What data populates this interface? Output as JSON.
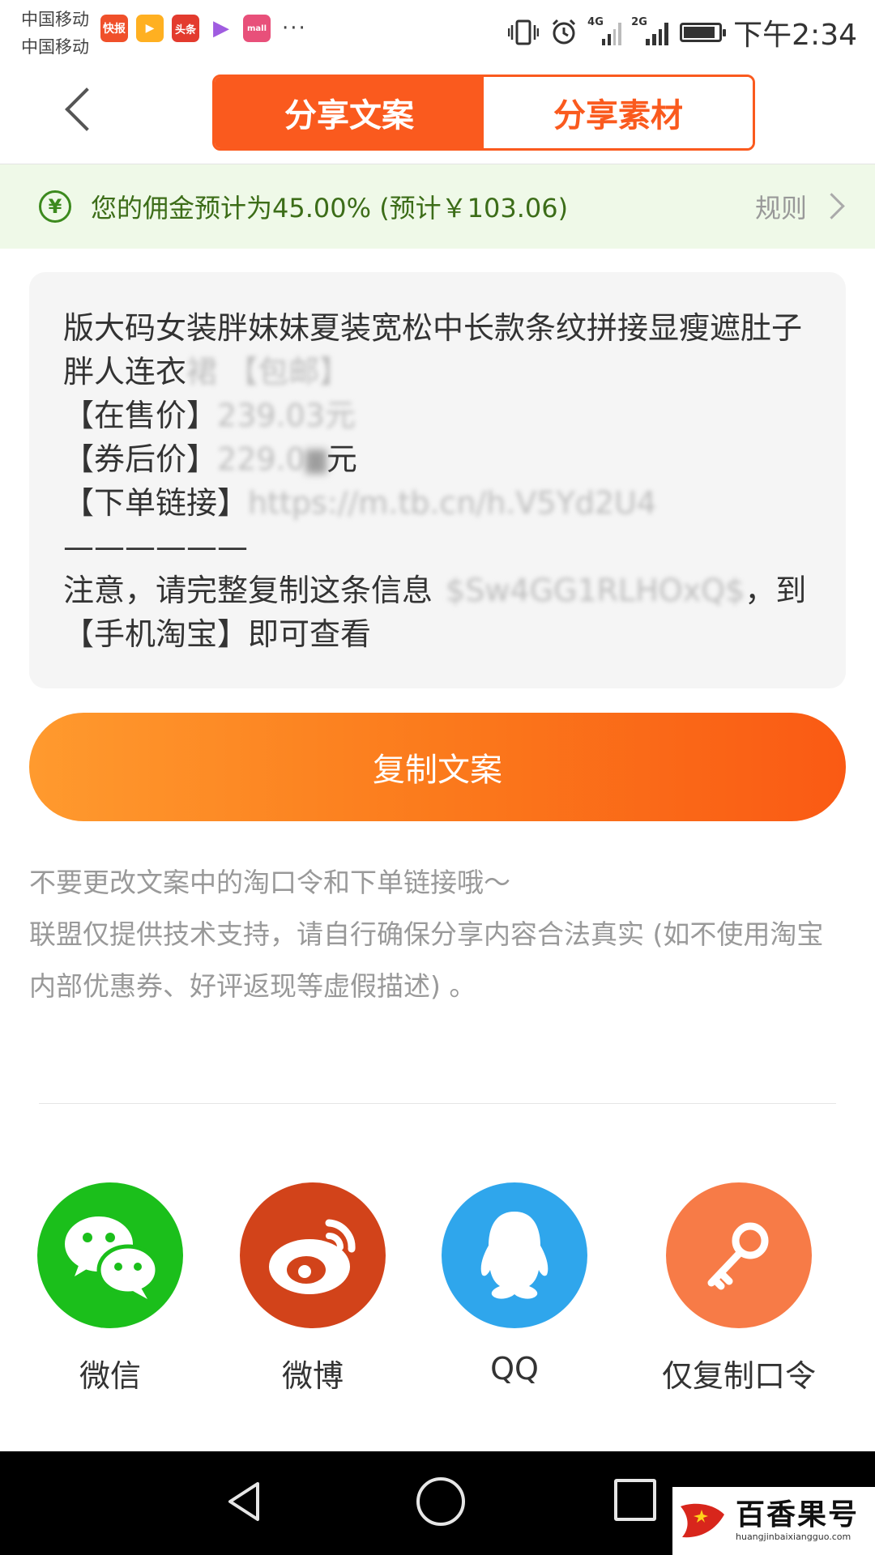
{
  "status_bar": {
    "carrier_1": "中国移动",
    "carrier_2": "中国移动",
    "time": "下午2:34",
    "network_1": "4G",
    "network_2": "2G",
    "app_icons": [
      "kuaibao-app-icon",
      "video-app-icon",
      "toutiao-app-icon",
      "play-app-icon",
      "mall-app-icon"
    ],
    "app_icon_labels": [
      "快报",
      "",
      "头条",
      "",
      "mall"
    ]
  },
  "header": {
    "tab_copywriting": "分享文案",
    "tab_material": "分享素材",
    "active_tab": "分享文案"
  },
  "banner": {
    "text": "您的佣金预计为45.00% (预计￥103.06)",
    "rule_label": "规则",
    "accent_color": "#3c8a1e"
  },
  "card": {
    "line1": "版大码女装胖妹妹夏装宽松中长款条纹拼接显瘦遮肚子",
    "line2_visible": "胖人连衣",
    "line2_blur": "裙 【包邮】",
    "line3_label": "【在售价】",
    "line3_value": "239.03元",
    "line4_label": "【券后价】",
    "line4_value": "229.0",
    "line4_unit": "元",
    "line5_label": "【下单链接】",
    "line5_value": "https://m.tb.cn/h.V5Yd2U4",
    "separator": "——————",
    "line6_start": "注意，请完整复制这条信息",
    "line6_code": "$Sw4GG1RLHOxQ$",
    "line6_end": "，到",
    "line7": "【手机淘宝】即可查看"
  },
  "copy_button": {
    "label": "复制文案"
  },
  "notes": {
    "line1": "不要更改文案中的淘口令和下单链接哦～",
    "line2": "联盟仅提供技术支持，请自行确保分享内容合法真实 (如不使用淘宝内部优惠券、好评返现等虚假描述) 。"
  },
  "share": {
    "wechat": "微信",
    "weibo": "微博",
    "qq": "QQ",
    "copy_code": "仅复制口令",
    "colors": {
      "wechat": "#1bbf1b",
      "weibo": "#d2431a",
      "qq": "#2fa6ec",
      "copy_code": "#f77b47"
    }
  },
  "watermark": {
    "title": "百香果号",
    "url": "huangjinbaixiangguo.com"
  },
  "brand_color": "#fa5a1e"
}
